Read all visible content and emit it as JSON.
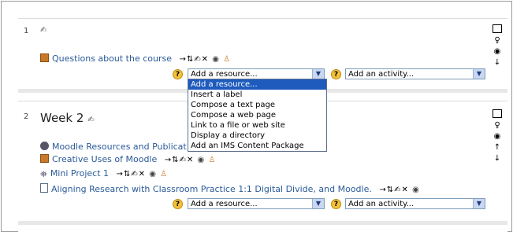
{
  "section1": {
    "number": "1",
    "item": "Questions about the course",
    "resource_select": "Add a resource...",
    "activity_select": "Add an activity..."
  },
  "section2": {
    "number": "2",
    "title": "Week 2",
    "items": [
      "Moodle Resources and Publicat",
      "Creative Uses of Moodle",
      "Mini Project 1",
      "Aligning Research with Classroom Practice 1:1 Digital Divide, and Moodle."
    ],
    "resource_select": "Add a resource...",
    "activity_select": "Add an activity..."
  },
  "dropdown_options": [
    "Add a resource...",
    "Insert a label",
    "Compose a text page",
    "Compose a web page",
    "Link to a file or web site",
    "Display a directory",
    "Add an IMS Content Package"
  ],
  "glyphs": {
    "pen": "✍",
    "help": "?",
    "arrow_down": "▼",
    "tools": "→⇅✍✕",
    "eye": "◉",
    "user": "♙",
    "bulb": "♀",
    "up": "↑",
    "down": "↓"
  }
}
